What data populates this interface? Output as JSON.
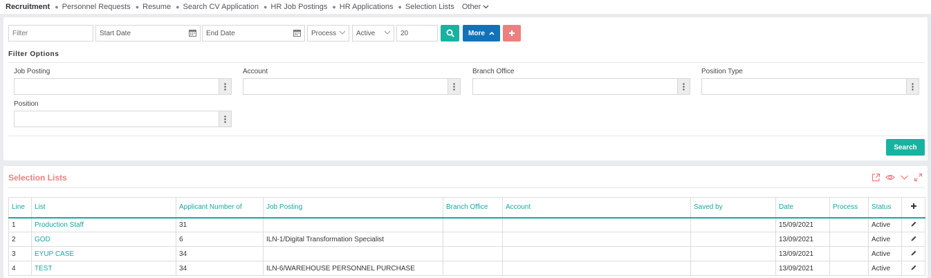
{
  "nav": {
    "items": [
      "Recruitment",
      "Personnel Requests",
      "Resume",
      "Search CV Application",
      "HR Job Postings",
      "HR Applications",
      "Selection Lists"
    ],
    "other": "Other"
  },
  "filter": {
    "filter_placeholder": "Filter",
    "start_date_placeholder": "Start Date",
    "end_date_placeholder": "End Date",
    "process_select": "Process",
    "status_select": "Active",
    "page_size": "20",
    "more_label": "More",
    "options_title": "Filter Options",
    "job_posting_label": "Job Posting",
    "account_label": "Account",
    "branch_office_label": "Branch Office",
    "position_type_label": "Position Type",
    "position_label": "Position",
    "search_label": "Search"
  },
  "colors": {
    "accent": "#1aa5a0",
    "primary": "#1172b8",
    "danger": "#ef7f7f"
  },
  "list": {
    "title": "Selection Lists",
    "columns": [
      "Line",
      "List",
      "Applicant Number of",
      "Job Posting",
      "Branch Office",
      "Account",
      "Saved by",
      "Date",
      "Process",
      "Status"
    ],
    "rows": [
      {
        "line": "1",
        "list": "Production Staff",
        "applicants": "31",
        "job_posting": "",
        "branch": "",
        "account": "",
        "saved_by": "",
        "date": "15/09/2021",
        "process": "",
        "status": "Active"
      },
      {
        "line": "2",
        "list": "GOD",
        "applicants": "6",
        "job_posting": "ILN-1/Digital Transformation Specialist",
        "branch": "",
        "account": "",
        "saved_by": "",
        "date": "13/09/2021",
        "process": "",
        "status": "Active"
      },
      {
        "line": "3",
        "list": "EYUP CASE",
        "applicants": "34",
        "job_posting": "",
        "branch": "",
        "account": "",
        "saved_by": "",
        "date": "13/09/2021",
        "process": "",
        "status": "Active"
      },
      {
        "line": "4",
        "list": "TEST",
        "applicants": "34",
        "job_posting": "ILN-6/WAREHOUSE PERSONNEL PURCHASE",
        "branch": "",
        "account": "",
        "saved_by": "",
        "date": "13/09/2021",
        "process": "",
        "status": "Active"
      }
    ]
  }
}
